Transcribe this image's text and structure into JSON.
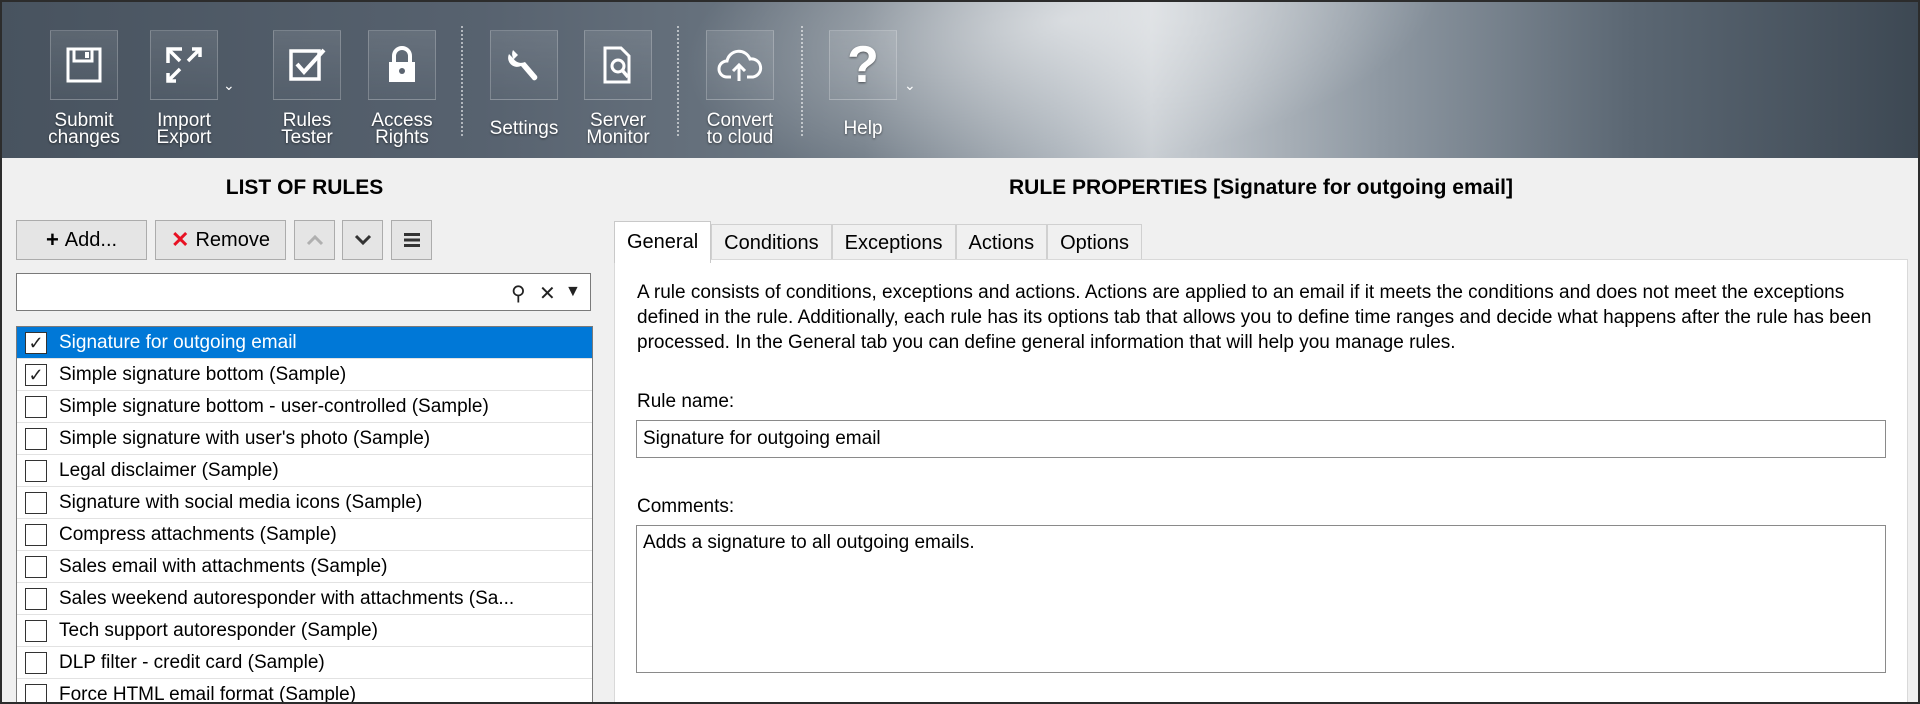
{
  "ribbon": {
    "buttons": [
      {
        "label": "Submit\nchanges",
        "icon": "save-icon"
      },
      {
        "label": "Import\nExport",
        "icon": "import-export-icon"
      },
      {
        "label": "Rules\nTester",
        "icon": "checkbox-icon"
      },
      {
        "label": "Access\nRights",
        "icon": "lock-icon"
      },
      {
        "label": "Settings",
        "icon": "wrench-icon"
      },
      {
        "label": "Server\nMonitor",
        "icon": "server-monitor-icon"
      },
      {
        "label": "Convert\nto cloud",
        "icon": "cloud-upload-icon"
      },
      {
        "label": "Help",
        "icon": "help-icon"
      }
    ]
  },
  "left": {
    "title": "LIST OF RULES",
    "add_label": "Add...",
    "remove_label": "Remove",
    "search_placeholder": "",
    "rules": [
      {
        "name": "Signature for outgoing email",
        "checked": true,
        "selected": true
      },
      {
        "name": "Simple signature bottom (Sample)",
        "checked": true,
        "selected": false
      },
      {
        "name": "Simple signature bottom - user-controlled (Sample)",
        "checked": false,
        "selected": false
      },
      {
        "name": "Simple signature with user's photo (Sample)",
        "checked": false,
        "selected": false
      },
      {
        "name": "Legal disclaimer (Sample)",
        "checked": false,
        "selected": false
      },
      {
        "name": "Signature with social media icons (Sample)",
        "checked": false,
        "selected": false
      },
      {
        "name": "Compress attachments (Sample)",
        "checked": false,
        "selected": false
      },
      {
        "name": "Sales email with attachments (Sample)",
        "checked": false,
        "selected": false
      },
      {
        "name": "Sales weekend autoresponder with attachments (Sa...",
        "checked": false,
        "selected": false
      },
      {
        "name": "Tech support autoresponder (Sample)",
        "checked": false,
        "selected": false
      },
      {
        "name": "DLP filter - credit card (Sample)",
        "checked": false,
        "selected": false
      },
      {
        "name": "Force HTML email format (Sample)",
        "checked": false,
        "selected": false
      }
    ]
  },
  "right": {
    "title": "RULE PROPERTIES [Signature for outgoing email]",
    "tabs": [
      "General",
      "Conditions",
      "Exceptions",
      "Actions",
      "Options"
    ],
    "active_tab": "General",
    "description": "A rule consists of conditions, exceptions and actions. Actions are applied to an email if it meets the conditions and does not meet the exceptions defined in the rule. Additionally, each rule has its options tab that allows you to define time ranges and decide what happens after the rule has been processed. In the General tab you can define general information that will help you manage rules.",
    "rule_name_label": "Rule name:",
    "rule_name_value": "Signature for outgoing email",
    "comments_label": "Comments:",
    "comments_value": "Adds a signature to all outgoing emails."
  },
  "colors": {
    "selection": "#0078d7",
    "remove_x": "#e81123"
  }
}
